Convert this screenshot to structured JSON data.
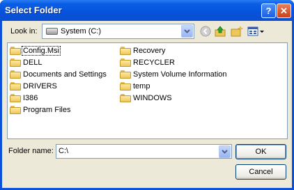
{
  "window": {
    "title": "Select Folder"
  },
  "titlebar_buttons": {
    "help": "?",
    "close": "✕"
  },
  "toolbar": {
    "look_in_label": "Look in:",
    "look_in_value": "System (C:)",
    "icons": [
      "drive-icon",
      "back-icon",
      "up-folder-icon",
      "new-folder-icon",
      "views-menu-icon"
    ]
  },
  "folders": {
    "col1": [
      "Config.Msi",
      "DELL",
      "Documents and Settings",
      "DRIVERS",
      "I386",
      "Program Files"
    ],
    "col2": [
      "Recovery",
      "RECYCLER",
      "System Volume Information",
      "temp",
      "WINDOWS"
    ],
    "selected": "Config.Msi"
  },
  "folder_name": {
    "label": "Folder name:",
    "value": "C:\\"
  },
  "buttons": {
    "ok": "OK",
    "cancel": "Cancel"
  },
  "colors": {
    "titlebar": "#0a5fe6",
    "client_bg": "#ece9d8",
    "folder": "#eec75a"
  }
}
